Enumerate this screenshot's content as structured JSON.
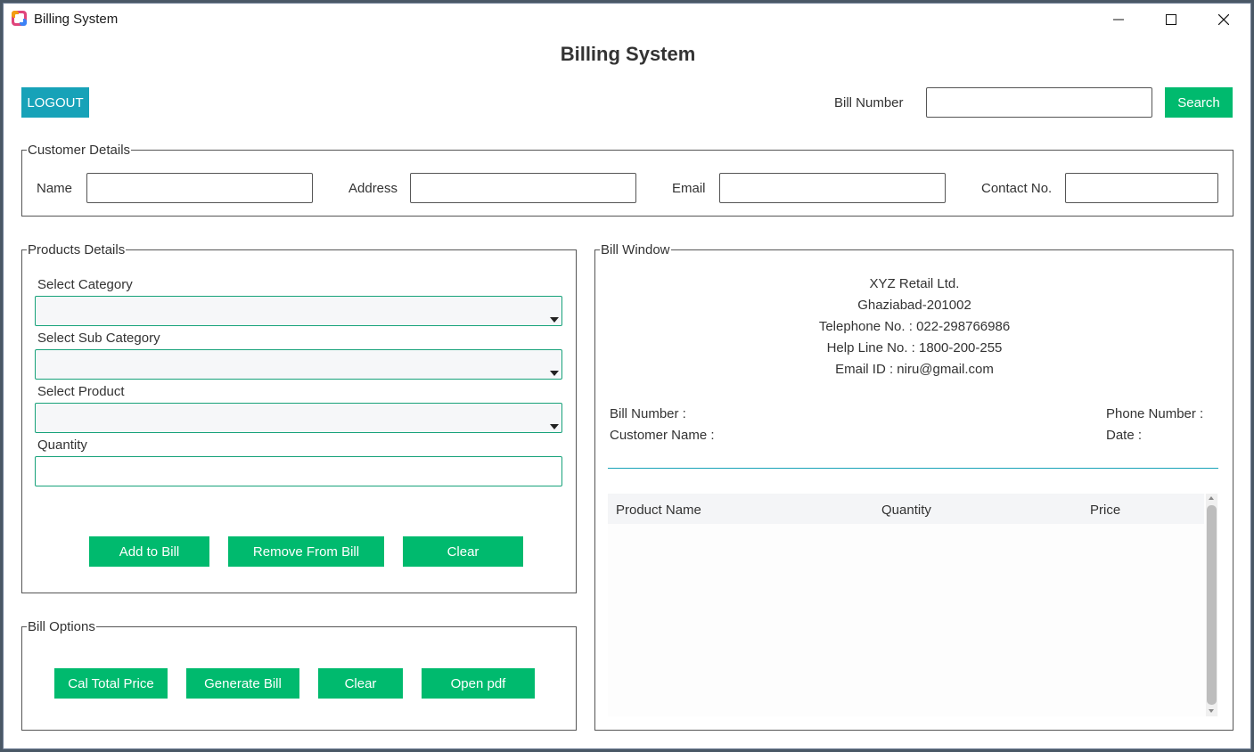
{
  "window": {
    "title": "Billing System",
    "controls": {
      "minimize": "—",
      "maximize": "☐",
      "close": "✕"
    }
  },
  "header": {
    "title": "Billing System",
    "logout_label": "LOGOUT",
    "bill_number_label": "Bill Number",
    "bill_number_value": "",
    "search_label": "Search"
  },
  "customer": {
    "frame_label": "Customer Details",
    "name_label": "Name",
    "name_value": "",
    "address_label": "Address",
    "address_value": "",
    "email_label": "Email",
    "email_value": "",
    "contact_label": "Contact No.",
    "contact_value": ""
  },
  "products": {
    "frame_label": "Products Details",
    "category_label": "Select Category",
    "category_value": "",
    "subcategory_label": "Select Sub Category",
    "subcategory_value": "",
    "product_label": "Select Product",
    "product_value": "",
    "quantity_label": "Quantity",
    "quantity_value": "",
    "add_label": "Add to Bill",
    "remove_label": "Remove From Bill",
    "clear_label": "Clear"
  },
  "bill_options": {
    "frame_label": "Bill Options",
    "total_label": "Cal Total Price",
    "generate_label": "Generate Bill",
    "clear_label": "Clear",
    "pdf_label": "Open pdf"
  },
  "bill_window": {
    "frame_label": "Bill Window",
    "company": "XYZ Retail Ltd.",
    "city": "Ghaziabad-201002",
    "telephone": "Telephone No. : 022-298766986",
    "helpline": "Help Line No. : 1800-200-255",
    "email": "Email ID : niru@gmail.com",
    "bill_number_label": "Bill Number :",
    "customer_name_label": "Customer Name :",
    "phone_number_label": "Phone Number :",
    "date_label": "Date :",
    "columns": [
      "Product Name",
      "Quantity",
      "Price"
    ]
  },
  "colors": {
    "accent_teal": "#17a2b8",
    "button_green": "#00ba6e"
  }
}
